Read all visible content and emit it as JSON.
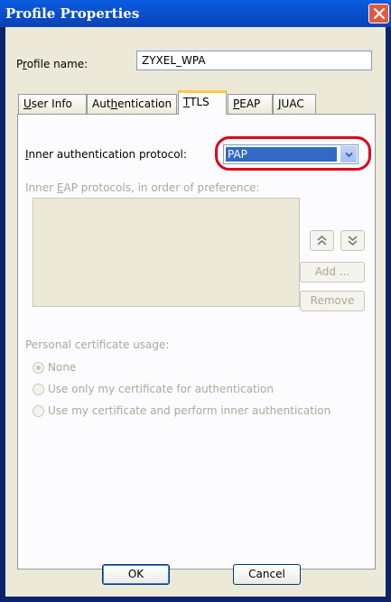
{
  "window": {
    "title": "Profile Properties"
  },
  "profile": {
    "label": "Profile name:",
    "value": "ZYXEL_WPA"
  },
  "tabs": [
    {
      "label": "User Info"
    },
    {
      "label": "Authentication"
    },
    {
      "label": "TTLS"
    },
    {
      "label": "PEAP"
    },
    {
      "label": "JUAC"
    }
  ],
  "ttls": {
    "inner_auth_label": "Inner authentication protocol:",
    "inner_auth_value": "PAP",
    "eap_label": "Inner EAP protocols, in order of preference:",
    "add_label": "Add ...",
    "remove_label": "Remove",
    "cert_label": "Personal certificate usage:",
    "radio_none": "None",
    "radio_only_my": "Use only my certificate for authentication",
    "radio_my_inner": "Use my certificate and perform inner authentication"
  },
  "footer": {
    "ok_label": "OK",
    "cancel_label": "Cancel"
  },
  "colors": {
    "highlight": "#e0001b",
    "selection": "#316ac5",
    "tab_accent": "#ffc83c"
  }
}
